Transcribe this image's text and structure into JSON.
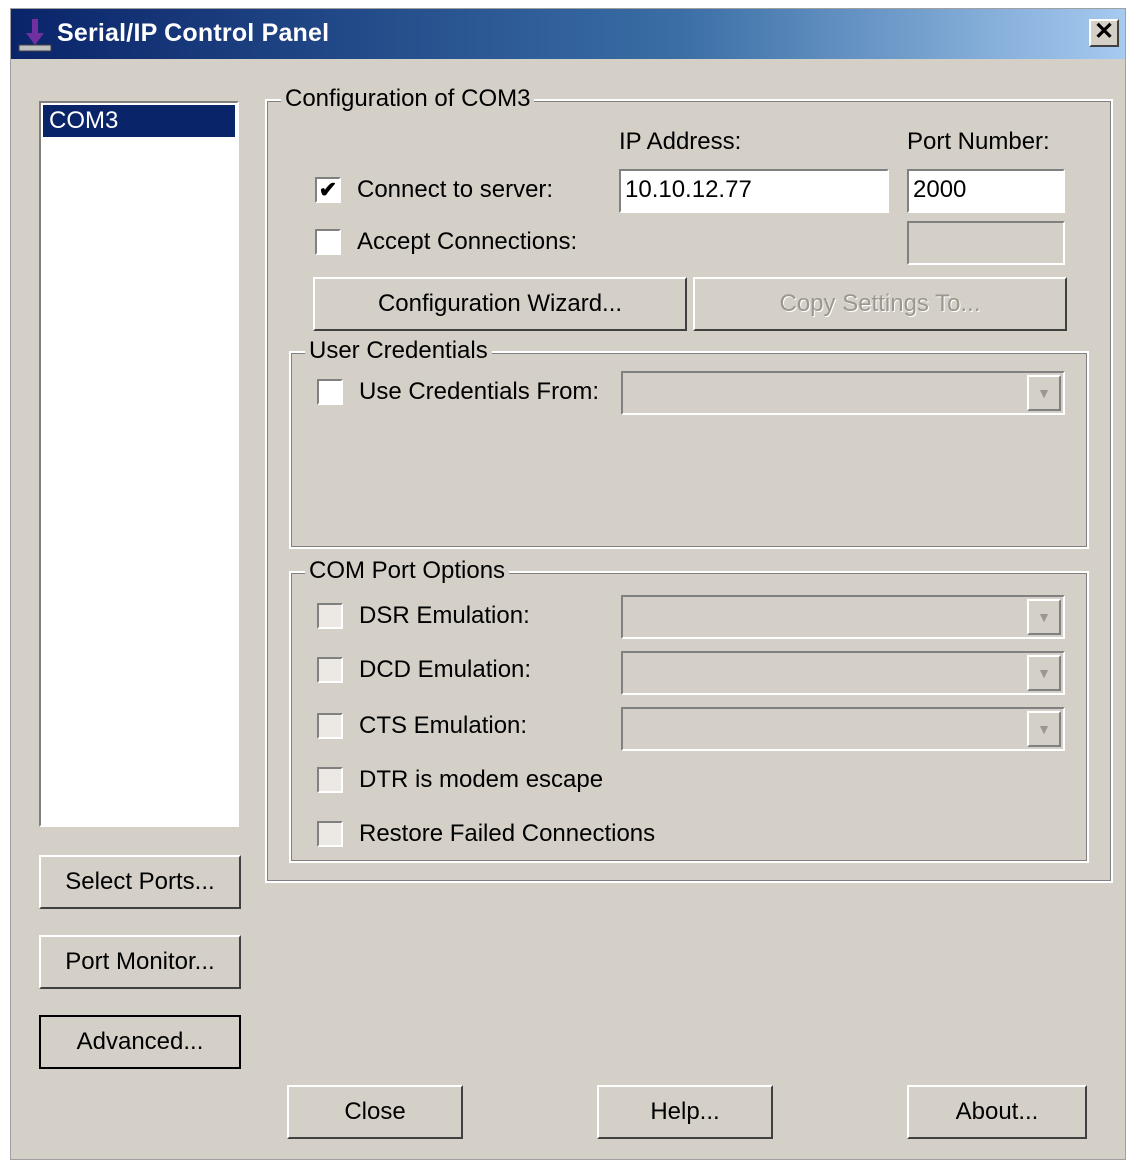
{
  "window": {
    "title": "Serial/IP Control Panel",
    "close_glyph": "✕",
    "title_icon": "download-arrow-icon"
  },
  "ports": {
    "items": [
      "COM3"
    ]
  },
  "left_buttons": {
    "select_ports": "Select Ports...",
    "port_monitor": "Port Monitor...",
    "advanced": "Advanced..."
  },
  "config": {
    "group_title": "Configuration of COM3",
    "ip_label": "IP Address:",
    "port_label": "Port Number:",
    "connect_label": "Connect to server:",
    "connect_checked": true,
    "ip_value": "10.10.12.77",
    "port_value": "2000",
    "accept_label": "Accept Connections:",
    "accept_checked": false,
    "wizard_button": "Configuration Wizard...",
    "copy_button": "Copy Settings To..."
  },
  "credentials": {
    "group_title": "User Credentials",
    "use_label": "Use Credentials From:",
    "use_checked": false
  },
  "com_options": {
    "group_title": "COM Port Options",
    "dsr_label": "DSR Emulation:",
    "dcd_label": "DCD Emulation:",
    "cts_label": "CTS Emulation:",
    "dtr_label": "DTR is modem escape",
    "restore_label": "Restore Failed Connections"
  },
  "bottom_buttons": {
    "close": "Close",
    "help": "Help...",
    "about": "About..."
  },
  "check_glyph": "✔",
  "arrow_glyph": "▼"
}
